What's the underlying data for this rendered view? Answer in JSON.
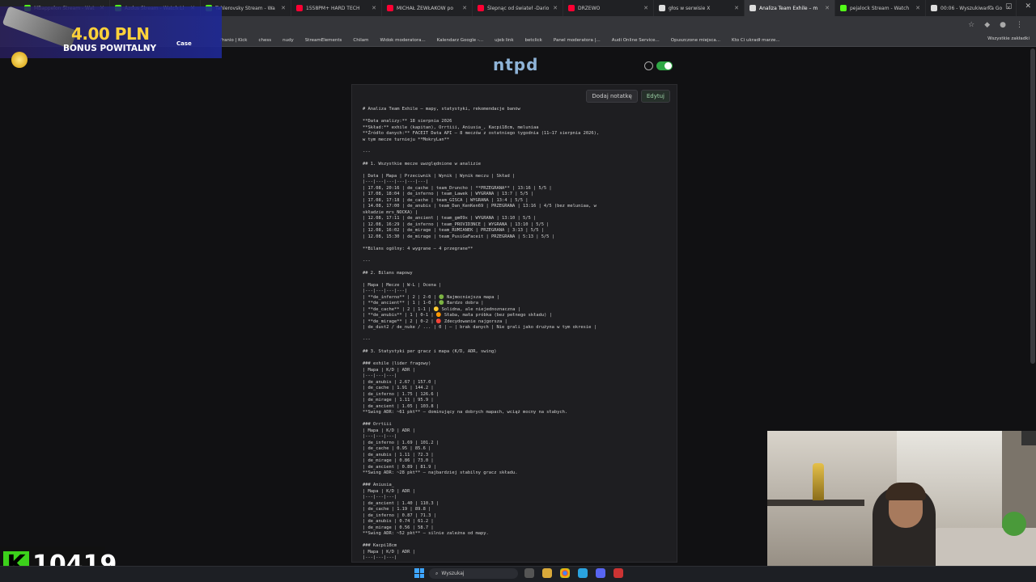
{
  "browser": {
    "tabs": [
      {
        "title": "MBappelon Stream - Wat",
        "color": "#53fc18",
        "active": false
      },
      {
        "title": "Azdus Stream - Watch Li",
        "color": "#53fc18",
        "active": false
      },
      {
        "title": "Tahlerovsky Stream - Wa",
        "color": "#53fc18",
        "active": false
      },
      {
        "title": "1558PM+ HARD TECH",
        "color": "#ff0033",
        "active": false
      },
      {
        "title": "MICHAŁ ŻEWŁAKOW po",
        "color": "#ff0033",
        "active": false
      },
      {
        "title": "Ślepnąc od świateł -Dario",
        "color": "#ff0033",
        "active": false
      },
      {
        "title": "DRZEWO",
        "color": "#ff0033",
        "active": false
      },
      {
        "title": "głos w serwisie X",
        "color": "#dddddd",
        "active": false
      },
      {
        "title": "Analiza Team Exhile – m",
        "color": "#dddddd",
        "active": true
      },
      {
        "title": "pejalock Stream - Watch",
        "color": "#53fc18",
        "active": false
      },
      {
        "title": "00:06 - Wyszukiwarka Go",
        "color": "#dddddd",
        "active": false
      }
    ],
    "bookmarks": [
      "Franio | Kick",
      "chess",
      "nudy",
      "StreamElements",
      "Chilam",
      "Widok moderatora...",
      "Kalendarz Google -...",
      "ujeb link",
      "betclick",
      "Panel moderatora |...",
      "Audi Online Service...",
      "Opuszczone miejsca...",
      "Kto Ci ukradł marze..."
    ],
    "bookmarks_folder": "Wszystkie zakładki"
  },
  "promo": {
    "amount": "4.00 PLN",
    "label": "BONUS POWITALNY",
    "brand": "Case"
  },
  "app": {
    "logo": "ntpd",
    "add_note_label": "Dodaj notatkę",
    "edit_label": "Edytuj"
  },
  "document": {
    "lines": [
      "# Analiza Team Exhile – mapy, statystyki, rekomendacje banów",
      "",
      "**Data analizy:** 18 sierpnia 2026",
      "**Skład:** exhile (kapitan), Orrtiii, Aniusia_, Kacpi18cm, meluniaa",
      "**Źródło danych:** FACEIT Data API – 8 meczów z ostatniego tygodnia (11–17 sierpnia 2026),",
      "w tym mecze turnieju **MokryLan**",
      "",
      "---",
      "",
      "## 1. Wszystkie mecze uwzględnione w analizie",
      "",
      "| Data | Mapa | Przeciwnik | Wynik | Wynik meczu | Skład |",
      "|---|---|---|---|---|---|",
      "| 17.08, 20:16 | de_cache | team_Druncho | **PRZEGRANA** | 13:16 | 5/5 |",
      "| 17.08, 18:04 | de_inferno | team_Lawek | WYGRANA | 13:7 | 5/5 |",
      "| 17.08, 17:18 | de_cache | team_GISCA | WYGRANA | 13:4 | 5/5 |",
      "| 14.08, 17:00 | de_anubis | team_Dan_KenKen69 | PRZEGRANA | 13:16 | 4/5 (bez meluniaa, w",
      "składzie mrs_NOCKA) |",
      "| 12.08, 17:11 | de_ancient | team_gm09x | WYGRANA | 13:10 | 5/5 |",
      "| 12.08, 16:29 | de_inferno | team_PROVID3NCE | WYGRANA | 13:10 | 5/5 |",
      "| 12.08, 16:02 | de_mirage | team_RUMIANEK | PRZEGRANA | 3:13 | 5/5 |",
      "| 12.08, 15:30 | de_mirage | team_PusiGaFaceit | PRZEGRANA | 5:13 | 5/5 |",
      "",
      "**Bilans ogólny: 4 wygrane – 4 przegrane**",
      "",
      "---",
      "",
      "## 2. Bilans mapowy",
      "",
      "| Mapa | Mecze | W-L | Ocena |",
      "|---|---|---|---|",
      "| **de_inferno** | 2 | 2-0 | 🟢 Najmocniejsza mapa |",
      "| **de_ancient** | 1 | 1-0 | 🟢 Bardzo dobra |",
      "| **de_cache** | 2 | 1-1 | 🟡 Solidna, ale niejednoznaczna |",
      "| **de_anubis** | 1 | 0-1 | 🟠 Słaba, mała próbka (bez pełnego składu) |",
      "| **de_mirage** | 2 | 0-2 | 🔴 Zdecydowanie najgorsza |",
      "| de_dust2 / de_nuke / ... | 0 | – | brak danych | Nie grali jako drużyna w tym okresie |",
      "",
      "---",
      "",
      "## 3. Statystyki per gracz i mapa (K/D, ADR, swing)",
      "",
      "### exhile (lider fragowy)",
      "| Mapa | K/D | ADR |",
      "|---|---|---|",
      "| de_anubis | 2.67 | 157.0 |",
      "| de_cache | 1.91 | 144.2 |",
      "| de_inferno | 1.75 | 126.6 |",
      "| de_mirage | 1.11 | 95.9 |",
      "| de_ancient | 1.05 | 103.8 |",
      "**Swing ADR: ~61 pkt** – dominujący na dobrych mapach, wciąż mocny na słabych.",
      "",
      "### Orrtiii",
      "| Mapa | K/D | ADR |",
      "|---|---|---|",
      "| de_inferno | 1.69 | 101.2 |",
      "| de_cache | 0.95 | 85.6 |",
      "| de_anubis | 1.11 | 72.3 |",
      "| de_mirage | 0.86 | 73.0 |",
      "| de_ancient | 0.89 | 81.9 |",
      "**Swing ADR: ~28 pkt** – najbardziej stabilny gracz składu.",
      "",
      "### Aniusia_",
      "| Mapa | K/D | ADR |",
      "|---|---|---|",
      "| de_ancient | 1.40 | 110.3 |",
      "| de_cache | 1.19 | 89.8 |",
      "| de_inferno | 0.87 | 71.3 |",
      "| de_anubis | 0.74 | 61.2 |",
      "| de_mirage | 0.56 | 58.7 |",
      "**Swing ADR: ~52 pkt** – silnie zależna od mapy.",
      "",
      "### Kacpi18cm",
      "| Mapa | K/D | ADR |",
      "|---|---|---|"
    ]
  },
  "overlay": {
    "k_letter": "K",
    "counter": "10419"
  },
  "taskbar": {
    "search_label": "Wyszukaj"
  }
}
